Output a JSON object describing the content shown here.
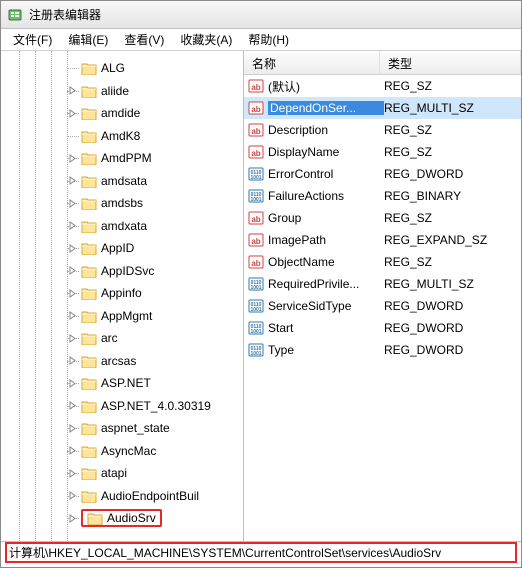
{
  "window": {
    "title": "注册表编辑器"
  },
  "menu": {
    "file": "文件(F)",
    "edit": "编辑(E)",
    "view": "查看(V)",
    "fav": "收藏夹(A)",
    "help": "帮助(H)"
  },
  "tree": {
    "items": [
      {
        "label": "ALG",
        "exp": false
      },
      {
        "label": "aliide",
        "exp": true
      },
      {
        "label": "amdide",
        "exp": true
      },
      {
        "label": "AmdK8",
        "exp": false
      },
      {
        "label": "AmdPPM",
        "exp": true
      },
      {
        "label": "amdsata",
        "exp": true
      },
      {
        "label": "amdsbs",
        "exp": true
      },
      {
        "label": "amdxata",
        "exp": true
      },
      {
        "label": "AppID",
        "exp": true
      },
      {
        "label": "AppIDSvc",
        "exp": true
      },
      {
        "label": "Appinfo",
        "exp": true
      },
      {
        "label": "AppMgmt",
        "exp": true
      },
      {
        "label": "arc",
        "exp": true
      },
      {
        "label": "arcsas",
        "exp": true
      },
      {
        "label": "ASP.NET",
        "exp": true
      },
      {
        "label": "ASP.NET_4.0.30319",
        "exp": true
      },
      {
        "label": "aspnet_state",
        "exp": true
      },
      {
        "label": "AsyncMac",
        "exp": true
      },
      {
        "label": "atapi",
        "exp": true
      },
      {
        "label": "AudioEndpointBuil",
        "exp": true
      },
      {
        "label": "AudioSrv",
        "exp": true,
        "hl": true
      }
    ]
  },
  "list": {
    "headers": {
      "name": "名称",
      "type": "类型"
    },
    "rows": [
      {
        "icon": "sz",
        "name": "(默认)",
        "type": "REG_SZ"
      },
      {
        "icon": "sz",
        "name": "DependOnSer...",
        "type": "REG_MULTI_SZ",
        "selected": true
      },
      {
        "icon": "sz",
        "name": "Description",
        "type": "REG_SZ"
      },
      {
        "icon": "sz",
        "name": "DisplayName",
        "type": "REG_SZ"
      },
      {
        "icon": "bin",
        "name": "ErrorControl",
        "type": "REG_DWORD"
      },
      {
        "icon": "bin",
        "name": "FailureActions",
        "type": "REG_BINARY"
      },
      {
        "icon": "sz",
        "name": "Group",
        "type": "REG_SZ"
      },
      {
        "icon": "sz",
        "name": "ImagePath",
        "type": "REG_EXPAND_SZ"
      },
      {
        "icon": "sz",
        "name": "ObjectName",
        "type": "REG_SZ"
      },
      {
        "icon": "bin",
        "name": "RequiredPrivile...",
        "type": "REG_MULTI_SZ"
      },
      {
        "icon": "bin",
        "name": "ServiceSidType",
        "type": "REG_DWORD"
      },
      {
        "icon": "bin",
        "name": "Start",
        "type": "REG_DWORD"
      },
      {
        "icon": "bin",
        "name": "Type",
        "type": "REG_DWORD"
      }
    ]
  },
  "status": {
    "path": "计算机\\HKEY_LOCAL_MACHINE\\SYSTEM\\CurrentControlSet\\services\\AudioSrv"
  }
}
